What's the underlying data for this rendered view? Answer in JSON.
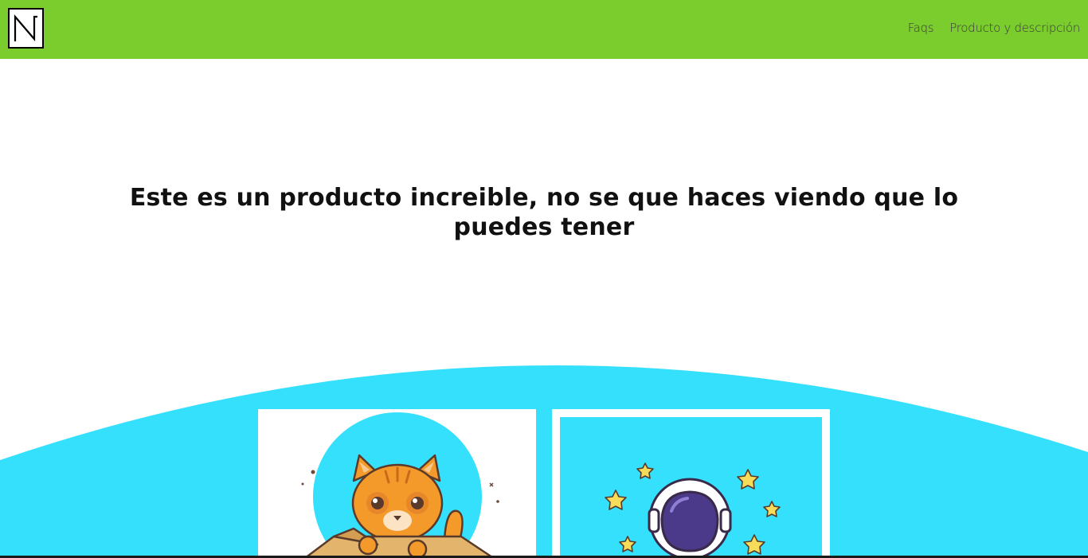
{
  "header": {
    "logo_icon": "monogram-logo-icon",
    "nav": [
      {
        "label": "Faqs"
      },
      {
        "label": "Producto y descripción"
      }
    ]
  },
  "hero": {
    "title": "Este es un producto increible, no se que haces viendo que lo puedes tener"
  },
  "cards": [
    {
      "image": "cat-in-box-illustration"
    },
    {
      "image": "astronaut-with-stars-illustration"
    }
  ],
  "colors": {
    "nav_background": "#7acd2c",
    "wave_background": "#35e0fd",
    "text": "#111111"
  }
}
